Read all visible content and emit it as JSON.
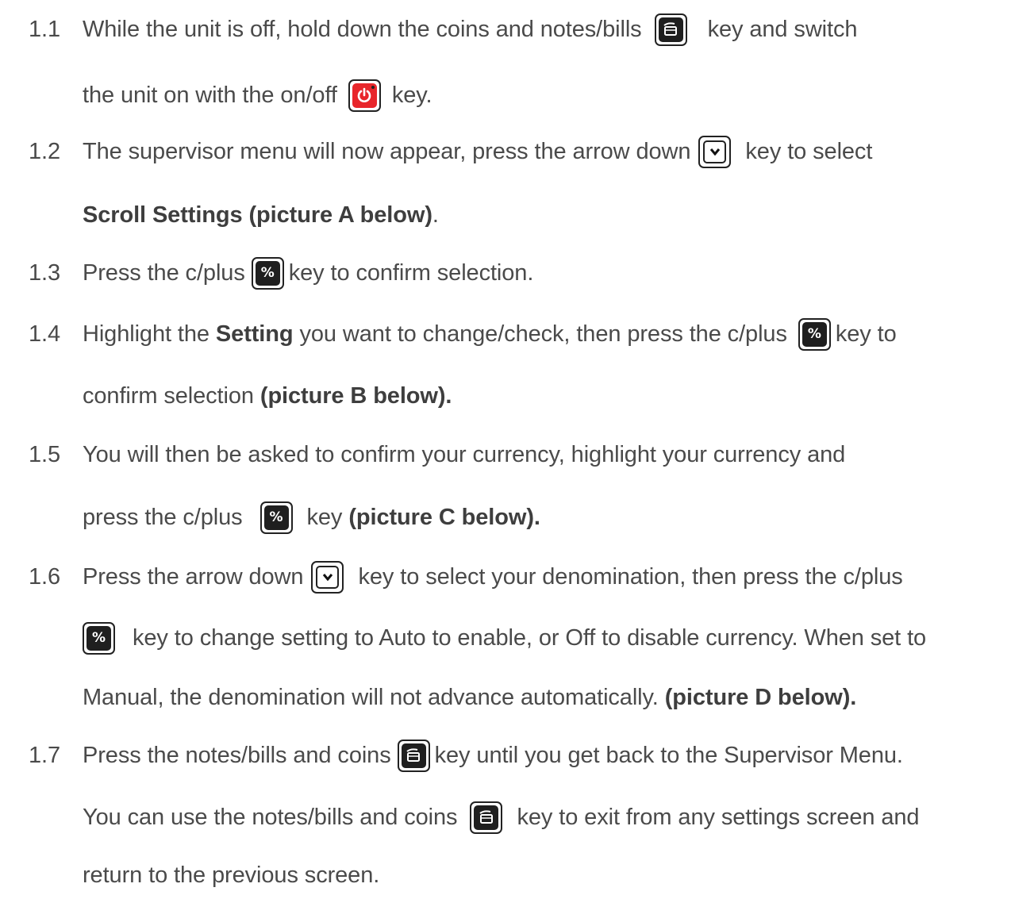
{
  "steps": [
    {
      "num": "1.1",
      "a": "While the unit is off, hold down the coins and notes/bills",
      "b": "key and switch",
      "c": "the unit on with the on/off",
      "d": "key."
    },
    {
      "num": "1.2",
      "a": "The supervisor menu will now appear, press the arrow down",
      "b": "key to select",
      "c": "Scroll Settings (picture A below)",
      "d": "."
    },
    {
      "num": "1.3",
      "a": "Press the c/plus",
      "b": "key to confirm selection."
    },
    {
      "num": "1.4",
      "a": "Highlight the",
      "a_bold": "Setting",
      "a2": "you want to change/check, then press the c/plus",
      "b": "key to",
      "c": "confirm selection",
      "c_bold": "(picture B below)."
    },
    {
      "num": "1.5",
      "a": "You will then be asked to confirm your currency, highlight your currency and",
      "c": "press the c/plus",
      "d": "key",
      "d_bold": "(picture C below)."
    },
    {
      "num": "1.6",
      "a": "Press the arrow down",
      "b": "key to select your denomination, then press the c/plus",
      "c": "key to change setting to Auto to enable, or Off to disable currency. When set to",
      "d": "Manual, the denomination will not advance automatically.",
      "d_bold": "(picture D below)."
    },
    {
      "num": "1.7",
      "a": "Press the notes/bills and coins",
      "b": "key until you get back to the Supervisor Menu.",
      "c": "You can use the notes/bills and coins",
      "d": "key to exit from any settings screen and",
      "e": "return to the previous screen."
    }
  ],
  "key_glyphs": {
    "cplus": "C/+",
    "arrow": "v"
  },
  "icons": {
    "coins_notes": "coins-notes-key-icon",
    "power": "power-key-icon",
    "arrow_down": "arrow-down-key-icon",
    "c_plus": "c-plus-key-icon"
  },
  "colors": {
    "text": "#4a4a4a",
    "power_red": "#e8262b",
    "key_dark": "#1f1f1f"
  }
}
